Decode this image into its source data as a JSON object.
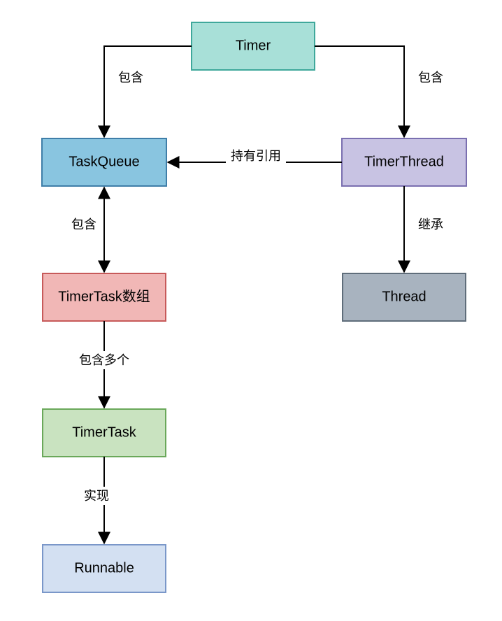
{
  "nodes": {
    "timer": {
      "label": "Timer",
      "fill": "#a8e0d8",
      "stroke": "#3fa89b"
    },
    "taskQueue": {
      "label": "TaskQueue",
      "fill": "#89c5e0",
      "stroke": "#3f7ea8"
    },
    "timerThread": {
      "label": "TimerThread",
      "fill": "#c8c3e3",
      "stroke": "#7a6fb0"
    },
    "timerTaskArr": {
      "label": "TimerTask数组",
      "fill": "#f1b7b6",
      "stroke": "#c75a5a"
    },
    "thread": {
      "label": "Thread",
      "fill": "#a8b3bf",
      "stroke": "#5f6d7a"
    },
    "timerTask": {
      "label": "TimerTask",
      "fill": "#c9e3c0",
      "stroke": "#6aa85a"
    },
    "runnable": {
      "label": "Runnable",
      "fill": "#d3e0f2",
      "stroke": "#7a97c9"
    }
  },
  "edges": {
    "timer_taskQueue": {
      "label": "包含"
    },
    "timer_timerThread": {
      "label": "包含"
    },
    "tt_to_tq": {
      "label": "持有引用"
    },
    "tq_arr": {
      "label": "包含"
    },
    "arr_task": {
      "label": "包含多个"
    },
    "task_run": {
      "label": "实现"
    },
    "tt_thread": {
      "label": "继承"
    }
  }
}
